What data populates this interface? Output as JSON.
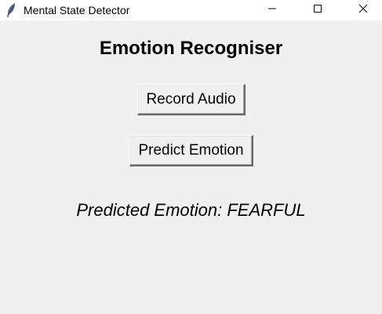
{
  "window": {
    "title": "Mental State Detector",
    "app_icon": "feather-icon",
    "controls": {
      "minimize_icon": "minimize-icon",
      "maximize_icon": "maximize-icon",
      "close_icon": "close-icon"
    }
  },
  "main": {
    "heading": "Emotion Recogniser",
    "record_button_label": "Record Audio",
    "predict_button_label": "Predict Emotion",
    "result_text": "Predicted Emotion: FEARFUL"
  },
  "colors": {
    "background": "#f0f0f0",
    "titlebar": "#ffffff",
    "text": "#000000"
  }
}
